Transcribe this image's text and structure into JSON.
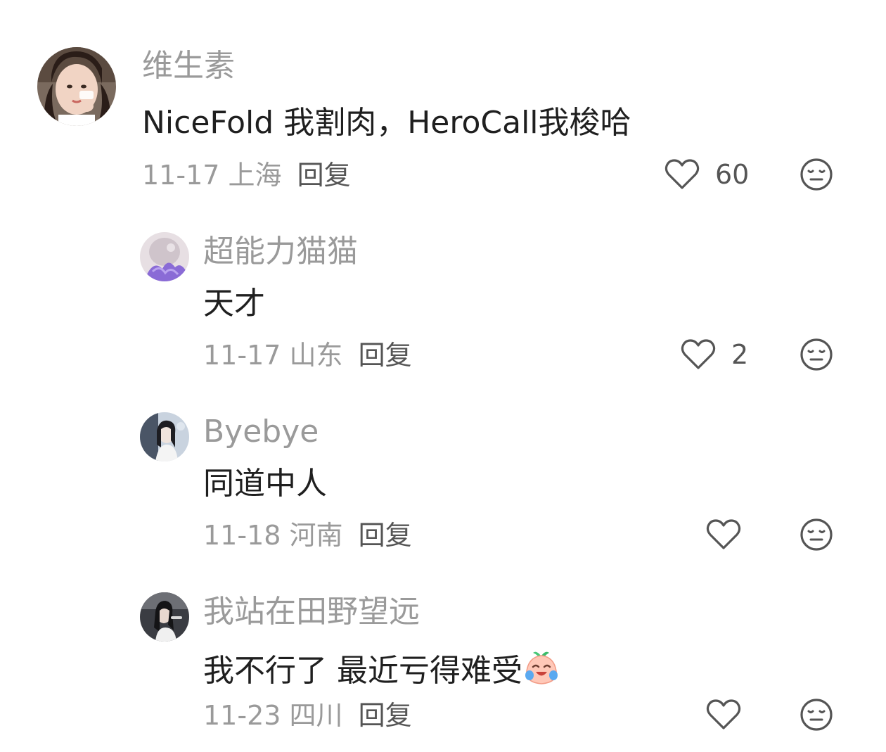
{
  "comments": [
    {
      "username": "维生素",
      "content": "NiceFold 我割肉，HeroCall我梭哈",
      "date": "11-17",
      "location": "上海",
      "reply_label": "回复",
      "like_count": "60"
    },
    {
      "username": "超能力猫猫",
      "content": "天才",
      "date": "11-17",
      "location": "山东",
      "reply_label": "回复",
      "like_count": "2"
    },
    {
      "username": "Byebye",
      "content": "同道中人",
      "date": "11-18",
      "location": "河南",
      "reply_label": "回复",
      "like_count": ""
    },
    {
      "username": "我站在田野望远",
      "content": "我不行了 最近亏得难受",
      "content_emoji": "crying-laughing-peach-emoji",
      "date": "11-23",
      "location": "四川",
      "reply_label": "回复",
      "like_count": ""
    }
  ],
  "icons": {
    "like": "heart-outline-icon",
    "dislike": "unamused-face-icon"
  },
  "colors": {
    "username": "#9a9a9a",
    "content": "#1f1f1f",
    "meta": "#9a9a9a",
    "reply": "#555555",
    "icon": "#555555"
  }
}
